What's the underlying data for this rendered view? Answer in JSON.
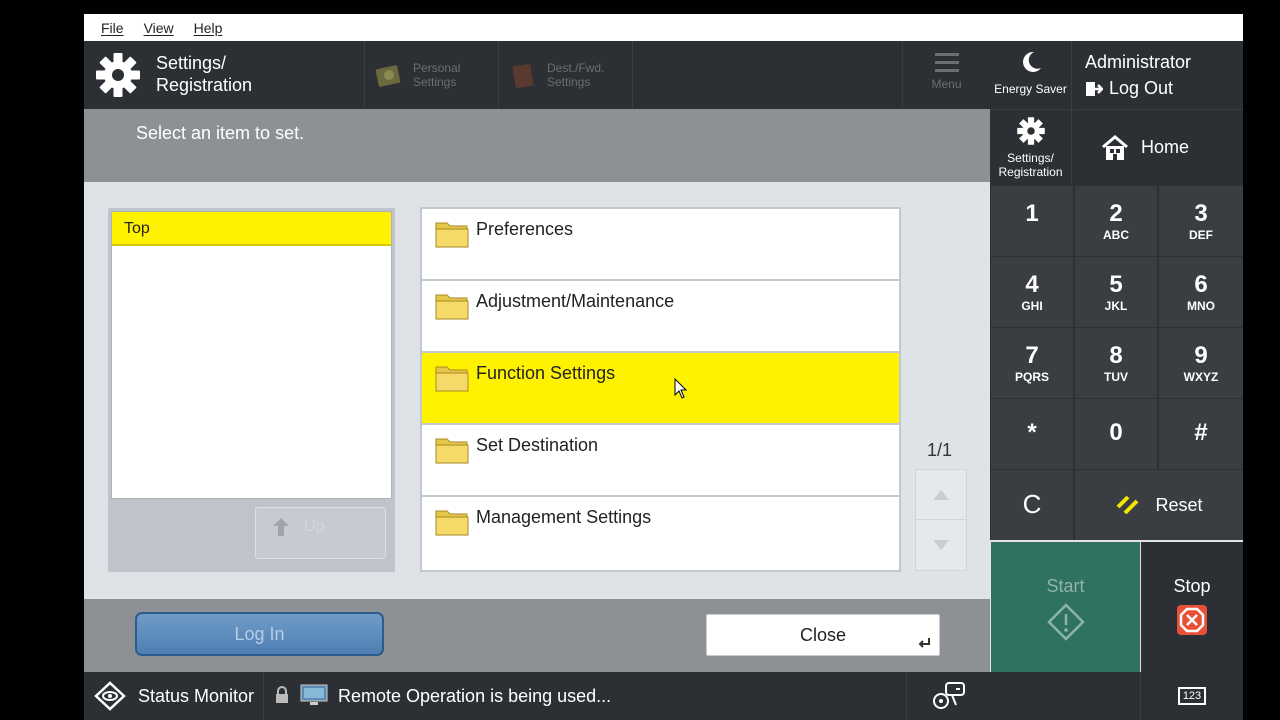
{
  "menubar": {
    "file": "File",
    "view": "View",
    "help": "Help"
  },
  "header": {
    "title_line1": "Settings/",
    "title_line2": "Registration",
    "personal_line1": "Personal",
    "personal_line2": "Settings",
    "dest_line1": "Dest./Fwd.",
    "dest_line2": "Settings",
    "menu": "Menu"
  },
  "right_panel": {
    "energy_saver": "Energy Saver",
    "user": "Administrator",
    "logout": "Log Out",
    "settings_line1": "Settings/",
    "settings_line2": "Registration",
    "home": "Home"
  },
  "instruction": "Select an item to set.",
  "tree": {
    "top": "Top",
    "up": "Up"
  },
  "items": [
    {
      "label": "Preferences",
      "selected": false
    },
    {
      "label": "Adjustment/Maintenance",
      "selected": false
    },
    {
      "label": "Function Settings",
      "selected": true
    },
    {
      "label": "Set Destination",
      "selected": false
    },
    {
      "label": "Management Settings",
      "selected": false
    }
  ],
  "pager": "1/1",
  "buttons": {
    "login": "Log In",
    "close": "Close"
  },
  "keypad": [
    {
      "n": "1",
      "s": ""
    },
    {
      "n": "2",
      "s": "ABC"
    },
    {
      "n": "3",
      "s": "DEF"
    },
    {
      "n": "4",
      "s": "GHI"
    },
    {
      "n": "5",
      "s": "JKL"
    },
    {
      "n": "6",
      "s": "MNO"
    },
    {
      "n": "7",
      "s": "PQRS"
    },
    {
      "n": "8",
      "s": "TUV"
    },
    {
      "n": "9",
      "s": "WXYZ"
    },
    {
      "n": "*",
      "s": ""
    },
    {
      "n": "0",
      "s": ""
    },
    {
      "n": "#",
      "s": ""
    }
  ],
  "clear": "C",
  "reset": "Reset",
  "start": "Start",
  "stop": "Stop",
  "status": {
    "monitor": "Status Monitor",
    "message": "Remote Operation is being used...",
    "input_mode": "123"
  },
  "colors": {
    "selection": "#fff200",
    "start": "#2f7260",
    "stop_icon": "#e8503a"
  }
}
